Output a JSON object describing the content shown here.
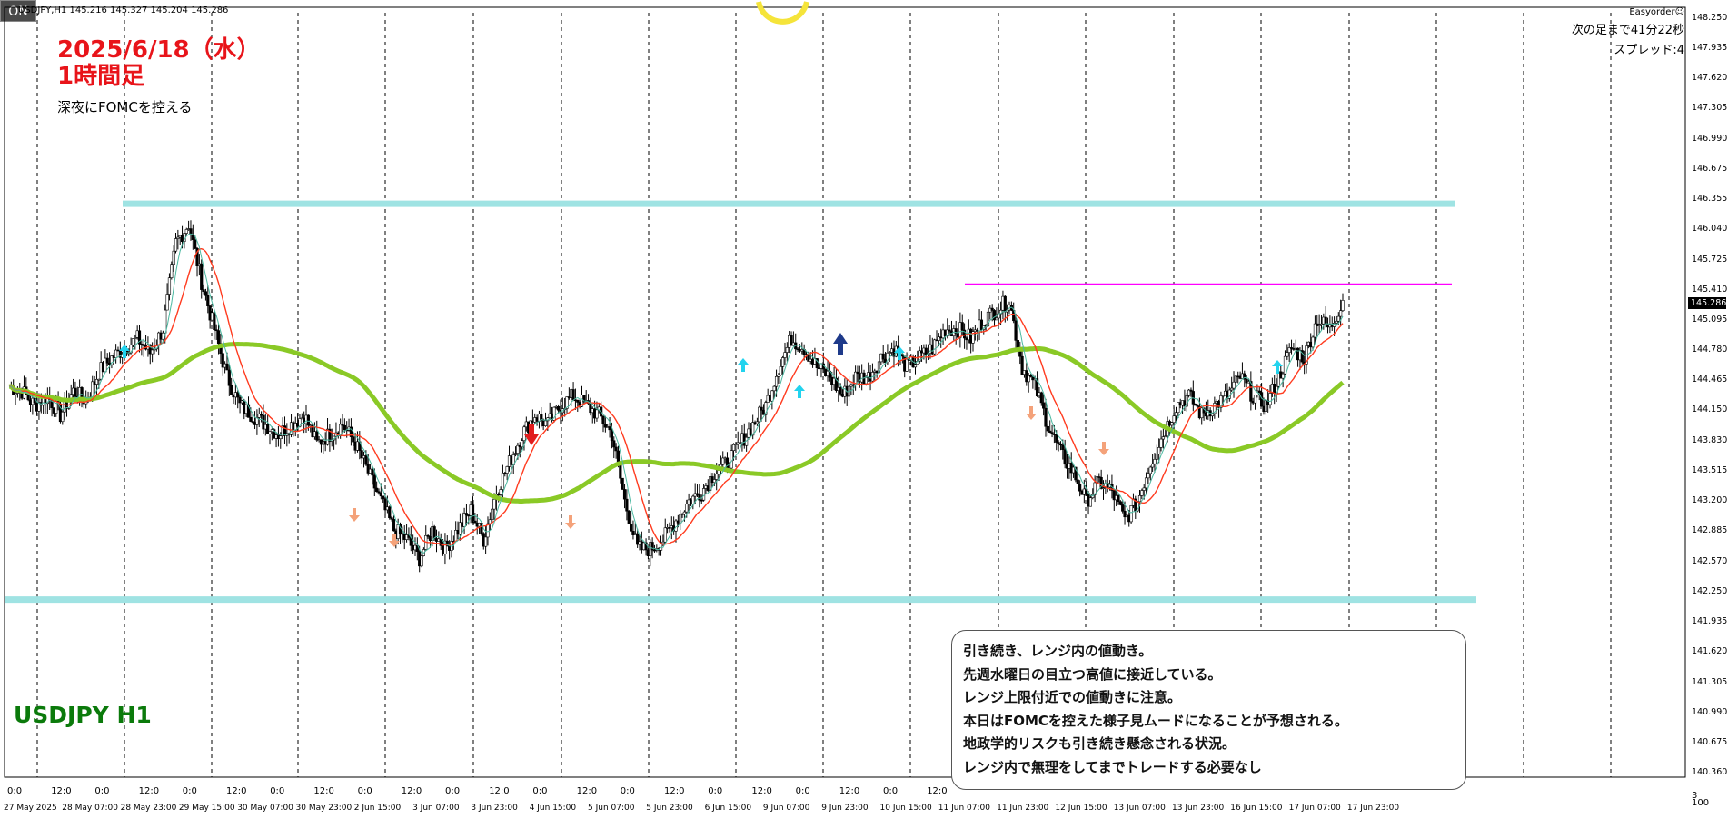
{
  "header": {
    "symbol_info": "USDJPY,H1  145.216 145.327 145.204 145.286"
  },
  "annotations": {
    "date_title": "2025/6/18（水）",
    "timeframe_title": "1時間足",
    "event_note": "深夜にFOMCを控える",
    "pair_label": "USDJPY H1"
  },
  "ea_panel": {
    "name": "Easyorder☺",
    "next_bar": "次の足まで41分22秒",
    "spread": "スプレッド:4",
    "on_button": "ON"
  },
  "comment": [
    "引き続き、レンジ内の値動き。",
    "先週水曜日の目立つ高値に接近している。",
    "レンジ上限付近での値動きに注意。",
    "本日はFOMCを控えた様子見ムードになることが予想される。",
    "地政学的リスクも引き続き懸念される状況。",
    "レンジ内で無理をしてまでトレードする必要なし"
  ],
  "price_axis": [
    "148.250",
    "147.935",
    "147.620",
    "147.305",
    "146.990",
    "146.675",
    "146.355",
    "146.040",
    "145.725",
    "145.410",
    "145.095",
    "144.780",
    "144.465",
    "144.150",
    "143.830",
    "143.515",
    "143.200",
    "142.885",
    "142.570",
    "142.250",
    "141.935",
    "141.620",
    "141.305",
    "140.990",
    "140.675",
    "140.360"
  ],
  "current_price": "145.286",
  "right_axis_extra": [
    "3",
    "100"
  ],
  "time_axis": [
    "0:0",
    "12:0",
    "0:0",
    "12:0",
    "0:0",
    "12:0",
    "0:0",
    "12:0",
    "0:0",
    "12:0",
    "0:0",
    "12:0",
    "0:0",
    "12:0",
    "0:0",
    "12:0",
    "0:0",
    "12:0",
    "0:0",
    "12:0",
    "0:0",
    "12:0"
  ],
  "date_axis": [
    "27 May 2025",
    "28 May 07:00",
    "28 May 23:00",
    "29 May 15:00",
    "30 May 07:00",
    "30 May 23:00",
    "2 Jun 15:00",
    "3 Jun 07:00",
    "3 Jun 23:00",
    "4 Jun 15:00",
    "5 Jun 07:00",
    "5 Jun 23:00",
    "6 Jun 15:00",
    "9 Jun 07:00",
    "9 Jun 23:00",
    "10 Jun 15:00",
    "11 Jun 07:00",
    "11 Jun 23:00",
    "12 Jun 15:00",
    "13 Jun 07:00",
    "13 Jun 23:00",
    "16 Jun 15:00",
    "17 Jun 07:00",
    "17 Jun 23:00"
  ],
  "chart_data": {
    "type": "candlestick",
    "symbol": "USDJPY",
    "timeframe": "H1",
    "ylim": [
      140.36,
      148.25
    ],
    "last_price": 145.286,
    "range_upper": 146.31,
    "range_lower": 142.17,
    "resistance_level": 145.47,
    "indicators": [
      "fast MA (teal)",
      "mid MA (red)",
      "long MA (green)"
    ],
    "close_path": [
      144.4,
      144.35,
      144.2,
      144.3,
      144.1,
      144.35,
      144.25,
      144.55,
      144.7,
      144.8,
      144.9,
      144.75,
      145.0,
      145.9,
      146.1,
      145.5,
      145.0,
      144.5,
      144.2,
      144.1,
      144.0,
      143.9,
      144.0,
      144.1,
      143.8,
      143.9,
      144.0,
      143.8,
      143.5,
      143.2,
      142.9,
      142.8,
      142.6,
      142.9,
      142.7,
      142.9,
      143.1,
      142.8,
      143.3,
      143.6,
      143.9,
      144.1,
      144.0,
      144.2,
      144.3,
      144.2,
      144.1,
      143.9,
      143.2,
      142.7,
      142.7,
      142.8,
      143.0,
      143.2,
      143.3,
      143.5,
      143.6,
      143.8,
      144.0,
      144.2,
      144.6,
      144.9,
      144.8,
      144.6,
      144.5,
      144.3,
      144.5,
      144.5,
      144.7,
      144.8,
      144.6,
      144.7,
      144.8,
      145.0,
      145.0,
      144.9,
      145.1,
      145.2,
      145.3,
      144.6,
      144.4,
      144.0,
      143.7,
      143.5,
      143.2,
      143.4,
      143.3,
      143.0,
      143.2,
      143.6,
      143.9,
      144.2,
      144.3,
      144.1,
      144.2,
      144.3,
      144.5,
      144.3,
      144.2,
      144.5,
      144.8,
      144.7,
      145.1,
      145.0,
      145.3
    ],
    "signals": {
      "up_arrows": [
        "28 May",
        "9 Jun",
        "9 Jun 23:00",
        "10 Jun",
        "16 Jun"
      ],
      "down_arrows": [
        "30 May",
        "2 Jun",
        "4 Jun",
        "11 Jun",
        "12 Jun"
      ]
    }
  },
  "colors": {
    "range_line": "#9fe3e3",
    "resistance_line": "#ff00ff",
    "long_ma": "#8ac926",
    "mid_ma": "#ff3b1f",
    "fast_ma": "#4bb8a0",
    "candle": "#000000",
    "up_arrow": "#22d3ee",
    "down_arrow": "#f4a27a"
  }
}
